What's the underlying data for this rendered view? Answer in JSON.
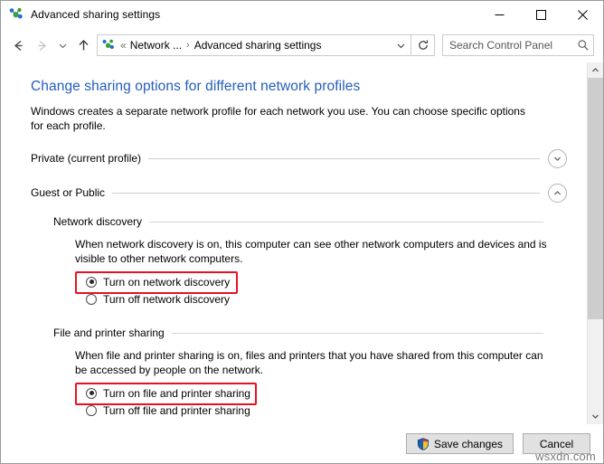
{
  "window": {
    "title": "Advanced sharing settings",
    "title_icon": "network-icon",
    "minimize_label": "Minimize",
    "maximize_label": "Maximize",
    "close_label": "Close"
  },
  "nav": {
    "back_label": "Back",
    "forward_label": "Forward",
    "recent_label": "Recent locations",
    "up_label": "Up",
    "refresh_label": "Refresh",
    "address_icon": "network-icon",
    "breadcrumb_prefix": "«",
    "breadcrumb": [
      "Network ...",
      "Advanced sharing settings"
    ],
    "breadcrumb_separator": "›",
    "dropdown_label": "Previous locations"
  },
  "search": {
    "placeholder": "Search Control Panel",
    "value": "",
    "icon": "search-icon"
  },
  "main": {
    "title": "Change sharing options for different network profiles",
    "description": "Windows creates a separate network profile for each network you use. You can choose specific options for each profile.",
    "profiles": [
      {
        "name": "Private (current profile)",
        "expanded": false,
        "chevron": "chevron-down-icon"
      },
      {
        "name": "Guest or Public",
        "expanded": true,
        "chevron": "chevron-up-icon"
      }
    ],
    "sections": [
      {
        "heading": "Network discovery",
        "description": "When network discovery is on, this computer can see other network computers and devices and is visible to other network computers.",
        "options": [
          {
            "label": "Turn on network discovery",
            "selected": true,
            "highlighted": true
          },
          {
            "label": "Turn off network discovery",
            "selected": false,
            "highlighted": false
          }
        ]
      },
      {
        "heading": "File and printer sharing",
        "description": "When file and printer sharing is on, files and printers that you have shared from this computer can be accessed by people on the network.",
        "options": [
          {
            "label": "Turn on file and printer sharing",
            "selected": true,
            "highlighted": true
          },
          {
            "label": "Turn off file and printer sharing",
            "selected": false,
            "highlighted": false
          }
        ]
      }
    ]
  },
  "footer": {
    "save_label": "Save changes",
    "save_icon": "uac-shield-icon",
    "cancel_label": "Cancel",
    "watermark": "wsxdn.com"
  },
  "scrollbar": {
    "up_icon": "scroll-up-icon",
    "down_icon": "scroll-down-icon"
  },
  "colors": {
    "title_blue": "#245dbd",
    "highlight_red": "#e81123",
    "shield_blue": "#1c5fad",
    "shield_gold": "#f2c230"
  }
}
